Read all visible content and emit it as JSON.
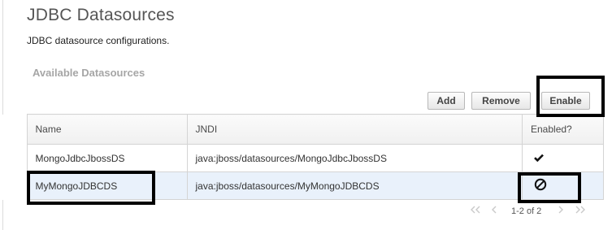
{
  "page": {
    "title": "JDBC Datasources",
    "description": "JDBC datasource configurations.",
    "section_title": "Available Datasources"
  },
  "toolbar": {
    "add_label": "Add",
    "remove_label": "Remove",
    "enable_label": "Enable"
  },
  "table": {
    "columns": [
      "Name",
      "JNDI",
      "Enabled?"
    ],
    "rows": [
      {
        "name": "MongoJdbcJbossDS",
        "jndi": "java:jboss/datasources/MongoJdbcJbossDS",
        "enabled": true,
        "status_icon": "checkmark-icon",
        "selected": false
      },
      {
        "name": "MyMongoJDBCDS",
        "jndi": "java:jboss/datasources/MyMongoJDBCDS",
        "enabled": false,
        "status_icon": "disabled-icon",
        "selected": true
      }
    ]
  },
  "pager": {
    "info": "1-2 of 2",
    "first_icon": "double-chevron-left-icon",
    "prev_icon": "chevron-left-icon",
    "next_icon": "chevron-right-icon",
    "last_icon": "double-chevron-right-icon"
  },
  "colors": {
    "selected_row": "#e9f1fb",
    "annotation_box": "#000000",
    "section_title": "#a6a6a6"
  }
}
